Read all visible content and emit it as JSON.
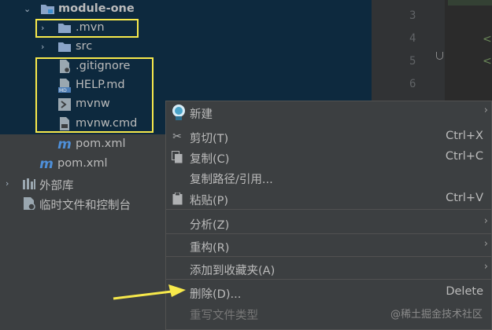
{
  "project_tree": {
    "module_label": "module-one",
    "items": [
      {
        "label": ".mvn"
      },
      {
        "label": "src"
      },
      {
        "label": ".gitignore"
      },
      {
        "label": "HELP.md",
        "badge": "MD"
      },
      {
        "label": "mvnw"
      },
      {
        "label": "mvnw.cmd"
      },
      {
        "label": "pom.xml",
        "badge": "m"
      },
      {
        "label": "pom.xml",
        "badge": "m"
      },
      {
        "label": "外部库"
      },
      {
        "label": "临时文件和控制台"
      }
    ]
  },
  "editor": {
    "line_numbers": [
      "3",
      "4",
      "5",
      "6"
    ]
  },
  "context_menu": {
    "new": "新建",
    "cut": "剪切(T)",
    "cut_shortcut": "Ctrl+X",
    "copy": "复制(C)",
    "copy_shortcut": "Ctrl+C",
    "copy_path": "复制路径/引用...",
    "paste": "粘贴(P)",
    "paste_shortcut": "Ctrl+V",
    "analyze": "分析(Z)",
    "refactor": "重构(R)",
    "add_to_favorites": "添加到收藏夹(A)",
    "delete": "删除(D)...",
    "delete_shortcut": "Delete",
    "override_file_type": "重写文件类型"
  },
  "watermark": "@稀土掘金技术社区",
  "colors": {
    "highlight_box": "#f7e94b",
    "arrow": "#f7e94b",
    "selection": "#0d293e",
    "folder": "#8aa4c8"
  }
}
